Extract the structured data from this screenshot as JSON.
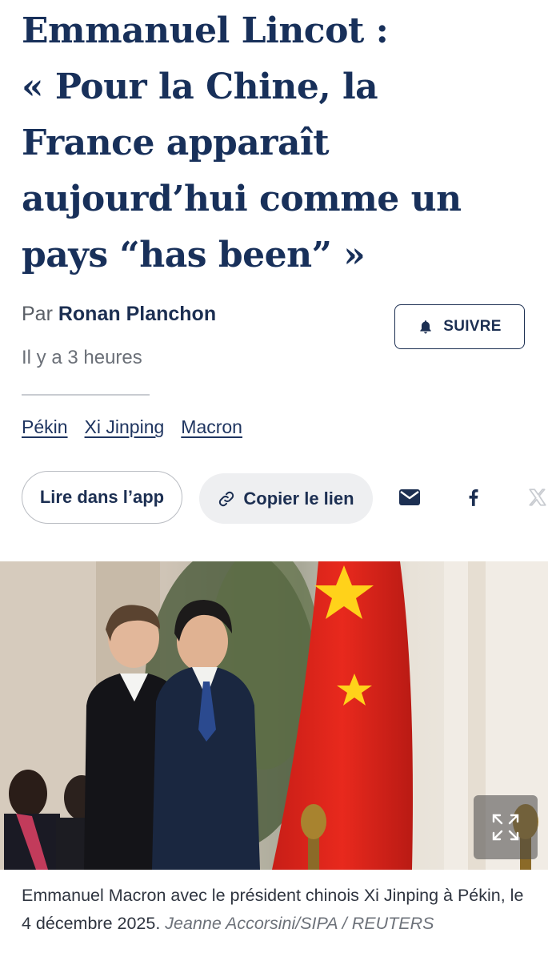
{
  "article": {
    "title_lines": [
      "Emmanuel Lincot :",
      "« Pour la Chine, la",
      "France apparaît",
      "aujourd’hui comme un",
      "pays “has been” »"
    ],
    "byline_prefix": "Par",
    "author": "Ronan Planchon",
    "published": "Il y a 3 heures",
    "follow_label": "SUIVRE",
    "tags": [
      "Pékin",
      "Xi Jinping",
      "Macron"
    ]
  },
  "share": {
    "open_app_label": "Lire dans l’app",
    "copy_link_label": "Copier le lien",
    "icons": [
      "link-icon",
      "mail-icon",
      "facebook-icon",
      "x-icon"
    ]
  },
  "photo": {
    "caption": "Emmanuel Macron avec le président chinois Xi Jinping à Pékin, le 4 décembre 2025.",
    "credit": "Jeanne Accorsini/SIPA / REUTERS"
  },
  "colors": {
    "title": "#18305a",
    "accent": "#1c2f52",
    "flag_red": "#e0261c",
    "flag_star": "#ffd21a"
  }
}
